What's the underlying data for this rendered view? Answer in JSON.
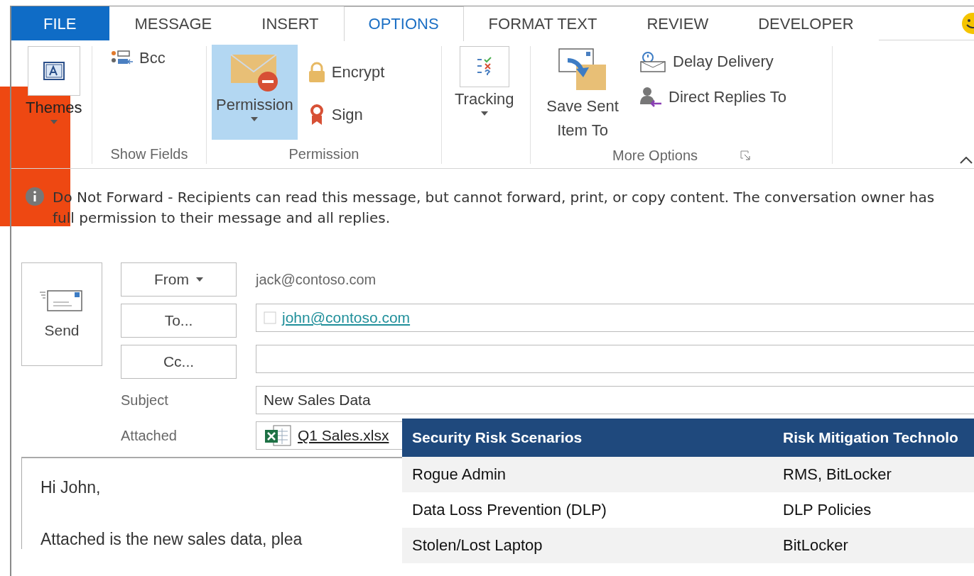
{
  "tabs": [
    {
      "label": "FILE",
      "kind": "file",
      "selected": false
    },
    {
      "label": "MESSAGE",
      "kind": "tab",
      "selected": false
    },
    {
      "label": "INSERT",
      "kind": "tab",
      "selected": false
    },
    {
      "label": "OPTIONS",
      "kind": "tab",
      "selected": true
    },
    {
      "label": "FORMAT TEXT",
      "kind": "tab",
      "selected": false
    },
    {
      "label": "REVIEW",
      "kind": "tab",
      "selected": false
    },
    {
      "label": "DEVELOPER",
      "kind": "tab",
      "selected": false
    }
  ],
  "ribbon": {
    "themes": {
      "label": "Themes"
    },
    "show_fields": {
      "label": "Show Fields",
      "bcc": "Bcc"
    },
    "permission": {
      "label": "Permission",
      "button": "Permission",
      "pressed": true,
      "encrypt": "Encrypt",
      "sign": "Sign"
    },
    "tracking": {
      "label": "Tracking"
    },
    "more_options": {
      "label": "More Options",
      "save_sent": "Save Sent Item To",
      "delay_delivery": "Delay Delivery",
      "direct_replies": "Direct Replies To"
    }
  },
  "info_bar": {
    "text": "Do Not Forward - Recipients can read this message, but cannot forward, print, or copy content. The conversation owner has full permission to their message and all replies."
  },
  "header": {
    "send": "Send",
    "from": "From",
    "from_value": "jack@contoso.com",
    "to": "To...",
    "to_value": "john@contoso.com",
    "cc": "Cc...",
    "subject_label": "Subject",
    "subject_value": "New Sales Data",
    "attached_label": "Attached",
    "attachment": "Q1 Sales.xlsx"
  },
  "body": {
    "lines": [
      "Hi John,",
      "Attached is the new sales data, plea"
    ]
  },
  "table": {
    "columns": [
      "Security Risk Scenarios",
      "Risk Mitigation Technolo"
    ],
    "rows": [
      [
        "Rogue Admin",
        "RMS, BitLocker"
      ],
      [
        "Data Loss Prevention (DLP)",
        "DLP Policies"
      ],
      [
        "Stolen/Lost Laptop",
        "BitLocker"
      ]
    ]
  }
}
